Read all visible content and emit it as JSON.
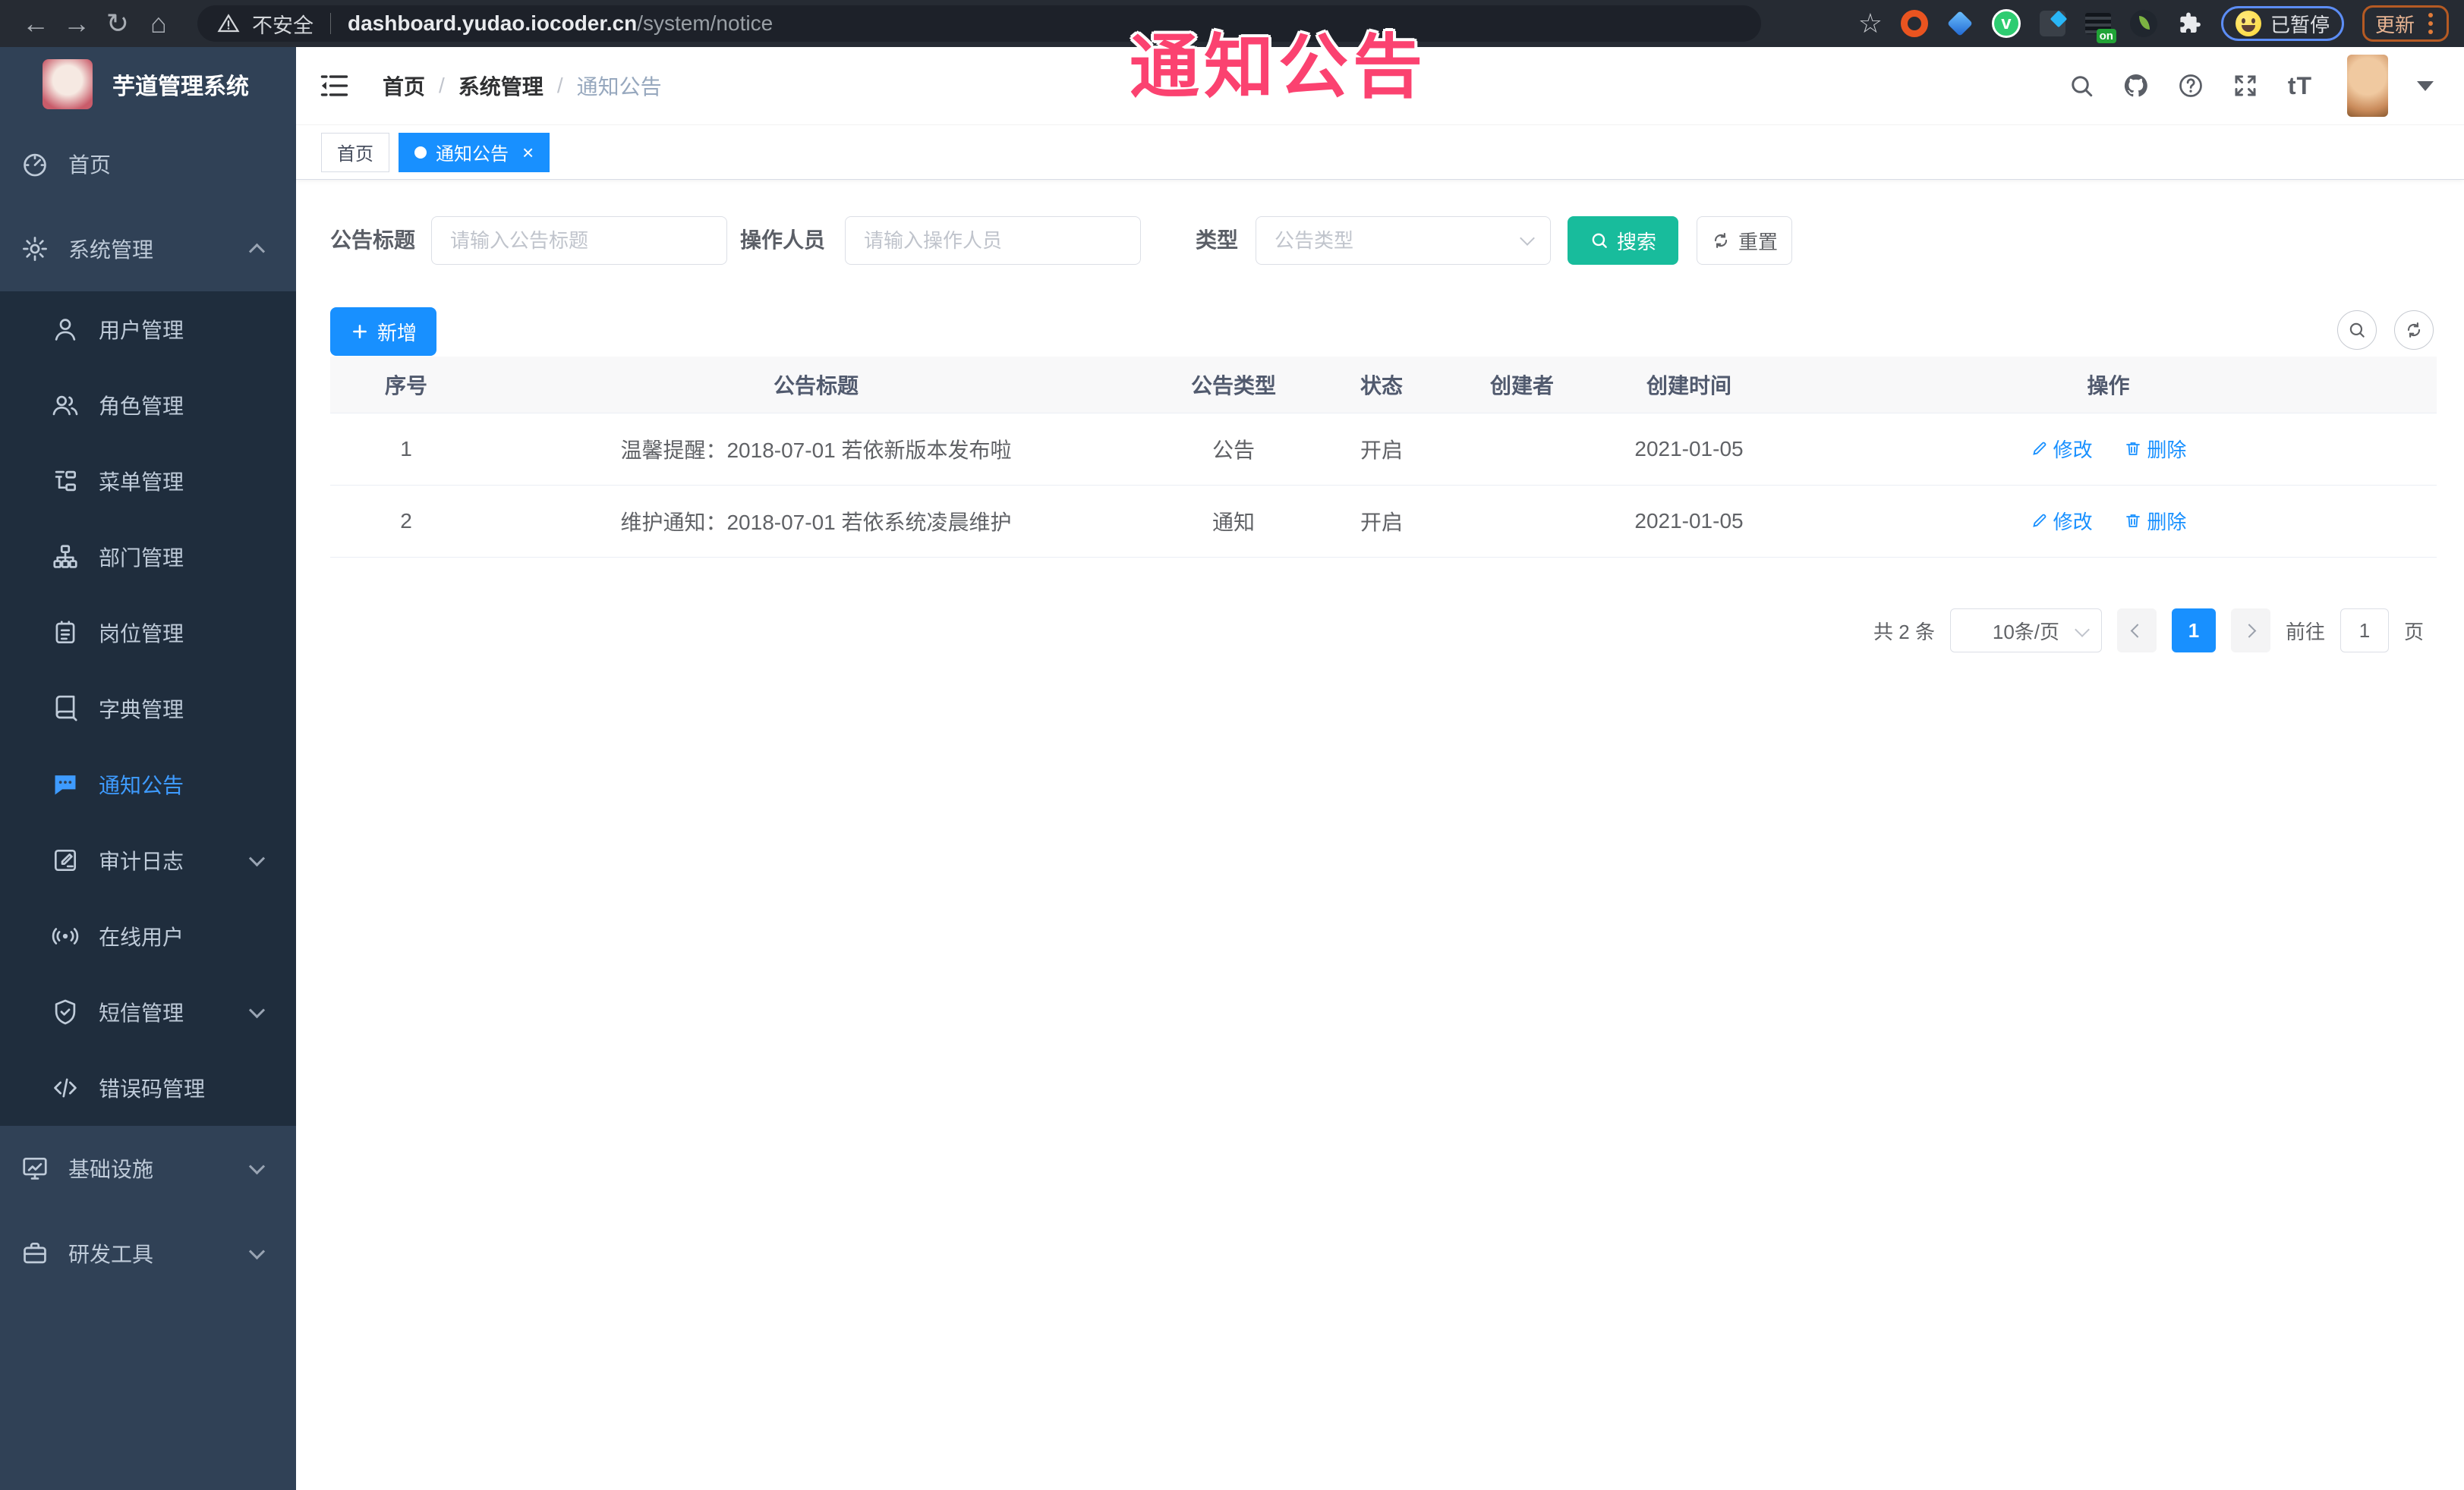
{
  "overlay": {
    "title": "通知公告",
    "color": "#fb4270"
  },
  "browser": {
    "security_label": "不安全",
    "url_host": "dashboard.yudao.iocoder.cn",
    "url_path": "/system/notice",
    "ext_on_badge": "on",
    "paused_label": "已暂停",
    "update_label": "更新"
  },
  "sidebar": {
    "app_title": "芋道管理系统",
    "top_items": [
      {
        "name": "sidebar-item-home",
        "label": "首页",
        "icon": "dashboard-icon"
      },
      {
        "name": "sidebar-item-system",
        "label": "系统管理",
        "icon": "gear-icon",
        "chevron": "up"
      }
    ],
    "sub_items": [
      {
        "name": "sidebar-item-users",
        "label": "用户管理",
        "icon": "user-icon"
      },
      {
        "name": "sidebar-item-roles",
        "label": "角色管理",
        "icon": "users-icon"
      },
      {
        "name": "sidebar-item-menus",
        "label": "菜单管理",
        "icon": "menu-tree-icon"
      },
      {
        "name": "sidebar-item-departments",
        "label": "部门管理",
        "icon": "org-tree-icon"
      },
      {
        "name": "sidebar-item-posts",
        "label": "岗位管理",
        "icon": "badge-icon"
      },
      {
        "name": "sidebar-item-dictionary",
        "label": "字典管理",
        "icon": "dictionary-icon"
      },
      {
        "name": "sidebar-item-notice",
        "label": "通知公告",
        "icon": "announcement-icon",
        "active": true
      },
      {
        "name": "sidebar-item-audit-log",
        "label": "审计日志",
        "icon": "audit-log-icon",
        "chevron": "down"
      },
      {
        "name": "sidebar-item-online-users",
        "label": "在线用户",
        "icon": "online-users-icon"
      },
      {
        "name": "sidebar-item-sms",
        "label": "短信管理",
        "icon": "sms-icon",
        "chevron": "down"
      },
      {
        "name": "sidebar-item-error-codes",
        "label": "错误码管理",
        "icon": "error-code-icon"
      }
    ],
    "bottom_items": [
      {
        "name": "sidebar-item-infrastructure",
        "label": "基础设施",
        "icon": "infrastructure-icon",
        "chevron": "down"
      },
      {
        "name": "sidebar-item-dev-tools",
        "label": "研发工具",
        "icon": "dev-tools-icon",
        "chevron": "down"
      }
    ]
  },
  "appbar": {
    "breadcrumb": [
      "首页",
      "系统管理",
      "通知公告"
    ],
    "font_size_icon_text": "tT"
  },
  "tags": {
    "items": [
      {
        "label": "首页"
      },
      {
        "label": "通知公告",
        "active": true,
        "close": "×"
      }
    ]
  },
  "filters": {
    "title_label": "公告标题",
    "title_placeholder": "请输入公告标题",
    "operator_label": "操作人员",
    "operator_placeholder": "请输入操作人员",
    "type_label": "类型",
    "type_placeholder": "公告类型",
    "search_label": "搜索",
    "reset_label": "重置"
  },
  "toolbar": {
    "add_label": "新增"
  },
  "table": {
    "columns": [
      "序号",
      "公告标题",
      "公告类型",
      "状态",
      "创建者",
      "创建时间",
      "操作"
    ],
    "ops": {
      "edit": "修改",
      "delete": "删除"
    },
    "rows": [
      {
        "index": "1",
        "title": "温馨提醒：2018-07-01 若依新版本发布啦",
        "type": "公告",
        "status": "开启",
        "creator": "",
        "created": "2021-01-05"
      },
      {
        "index": "2",
        "title": "维护通知：2018-07-01 若依系统凌晨维护",
        "type": "通知",
        "status": "开启",
        "creator": "",
        "created": "2021-01-05"
      }
    ]
  },
  "pagination": {
    "total_text": "共 2 条",
    "page_size": "10条/页",
    "current_page": "1",
    "goto_label": "前往",
    "goto_value": "1",
    "unit_label": "页"
  },
  "colors": {
    "primary": "#1890ff",
    "search_button": "#18bc9c",
    "sidebar_bg": "#304156",
    "submenu_bg": "#1f2d3d"
  }
}
